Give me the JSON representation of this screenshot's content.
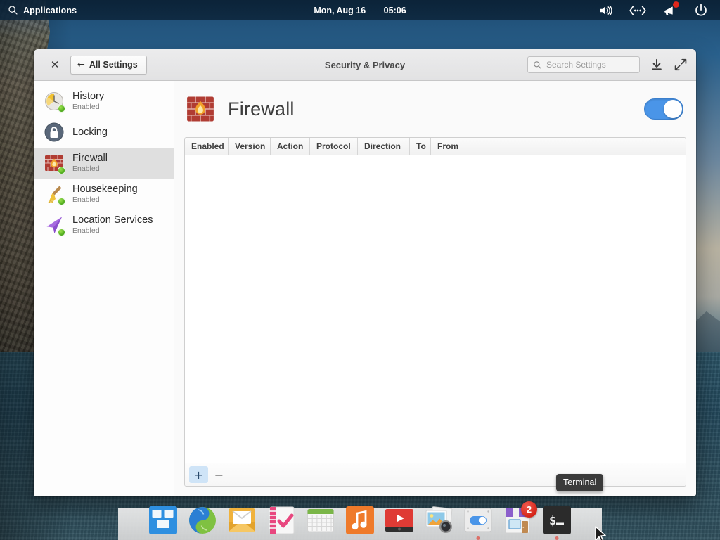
{
  "topbar": {
    "applications_label": "Applications",
    "search_icon": "search-icon",
    "date": "Mon, Aug 16",
    "time": "05:06",
    "indicators": [
      {
        "name": "volume-icon",
        "label": "Sound"
      },
      {
        "name": "network-icon",
        "label": "Network"
      },
      {
        "name": "notifications-icon",
        "label": "Notifications",
        "badge": true
      },
      {
        "name": "power-icon",
        "label": "Session"
      }
    ]
  },
  "window": {
    "title": "Security & Privacy",
    "close_label": "✕",
    "back_button": "All Settings",
    "back_arrow": "←",
    "search": {
      "placeholder": "Search Settings",
      "value": "",
      "icon": "search-icon"
    },
    "titlebar_buttons": [
      {
        "name": "download-icon",
        "label": "Install Updates"
      },
      {
        "name": "maximize-icon",
        "label": "Maximize"
      }
    ]
  },
  "sidebar": {
    "items": [
      {
        "label": "History",
        "status": "Enabled",
        "icon": "history-icon",
        "selected": false,
        "enabled": true
      },
      {
        "label": "Locking",
        "status": "",
        "icon": "lock-icon",
        "selected": false,
        "enabled": false
      },
      {
        "label": "Firewall",
        "status": "Enabled",
        "icon": "firewall-icon",
        "selected": true,
        "enabled": true
      },
      {
        "label": "Housekeeping",
        "status": "Enabled",
        "icon": "broom-icon",
        "selected": false,
        "enabled": true
      },
      {
        "label": "Location Services",
        "status": "Enabled",
        "icon": "location-arrow-icon",
        "selected": false,
        "enabled": true
      }
    ]
  },
  "main": {
    "page_title": "Firewall",
    "page_icon": "firewall-icon",
    "toggle": {
      "name": "firewall-toggle",
      "state": "on",
      "accent": "#4a95e8"
    },
    "table": {
      "columns": [
        "Enabled",
        "Version",
        "Action",
        "Protocol",
        "Direction",
        "To",
        "From"
      ],
      "rows": []
    },
    "footer": {
      "add_label": "+",
      "remove_label": "−"
    }
  },
  "tooltip": {
    "text": "Terminal"
  },
  "dock": {
    "items": [
      {
        "name": "applications-icon",
        "label": "Applications",
        "running": false
      },
      {
        "name": "web-browser-icon",
        "label": "Web",
        "running": false
      },
      {
        "name": "mail-icon",
        "label": "Mail",
        "running": false
      },
      {
        "name": "tasks-icon",
        "label": "Tasks",
        "running": false
      },
      {
        "name": "calendar-icon",
        "label": "Calendar",
        "running": false
      },
      {
        "name": "music-icon",
        "label": "Music",
        "running": false
      },
      {
        "name": "videos-icon",
        "label": "Videos",
        "running": false
      },
      {
        "name": "photos-icon",
        "label": "Photos",
        "running": false
      },
      {
        "name": "system-settings-icon",
        "label": "System Settings",
        "running": true
      },
      {
        "name": "appcenter-icon",
        "label": "AppCenter",
        "running": false,
        "badge": "2"
      },
      {
        "name": "terminal-icon",
        "label": "Terminal",
        "running": true
      }
    ]
  }
}
